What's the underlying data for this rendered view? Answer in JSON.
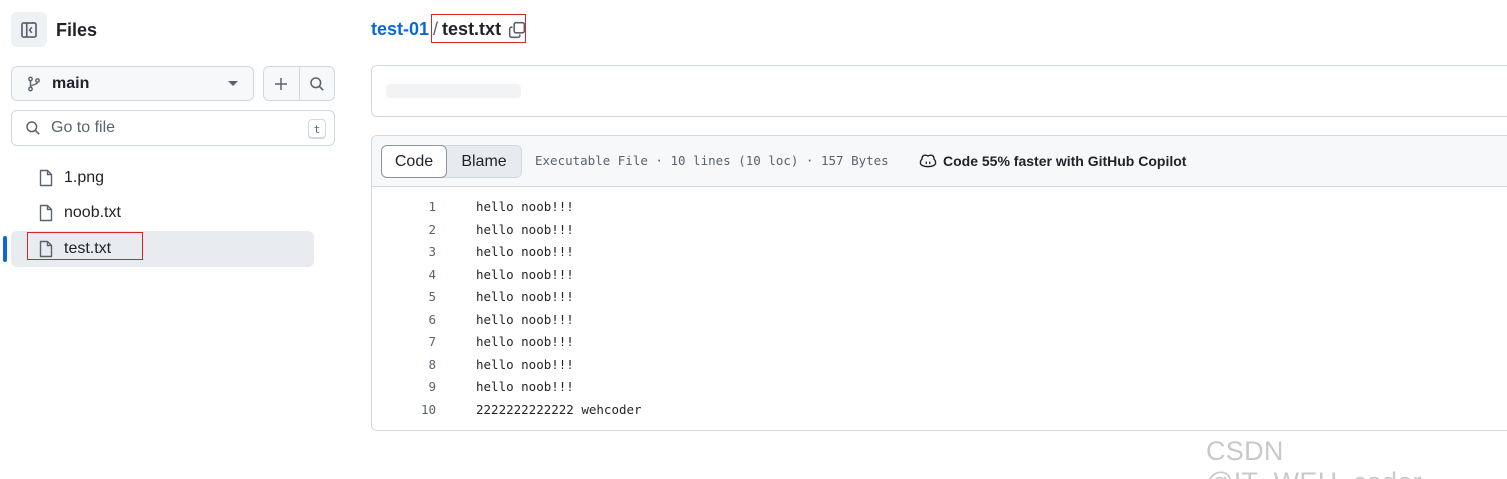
{
  "sidebar": {
    "title": "Files",
    "branch": "main",
    "search_placeholder": "Go to file",
    "search_shortcut": "t",
    "files": [
      {
        "name": "1.png",
        "selected": false
      },
      {
        "name": "noob.txt",
        "selected": false
      },
      {
        "name": "test.txt",
        "selected": true
      }
    ]
  },
  "breadcrumb": {
    "repo": "test-01",
    "separator": "/",
    "file": "test.txt"
  },
  "file_view": {
    "tabs": {
      "code": "Code",
      "blame": "Blame"
    },
    "meta": "Executable File · 10 lines (10 loc) · 157 Bytes",
    "copilot": "Code 55% faster with GitHub Copilot",
    "lines": [
      {
        "n": "1",
        "text": "hello noob!!!"
      },
      {
        "n": "2",
        "text": "hello noob!!!"
      },
      {
        "n": "3",
        "text": "hello noob!!!"
      },
      {
        "n": "4",
        "text": "hello noob!!!"
      },
      {
        "n": "5",
        "text": "hello noob!!!"
      },
      {
        "n": "6",
        "text": "hello noob!!!"
      },
      {
        "n": "7",
        "text": "hello noob!!!"
      },
      {
        "n": "8",
        "text": "hello noob!!!"
      },
      {
        "n": "9",
        "text": "hello noob!!!"
      },
      {
        "n": "10",
        "text": "2222222222222 wehcoder"
      }
    ]
  },
  "watermark": "CSDN @IT_WEH_coder",
  "colors": {
    "link": "#0969da",
    "selection_bar": "#0969da",
    "annotation_box": "#d62525"
  }
}
